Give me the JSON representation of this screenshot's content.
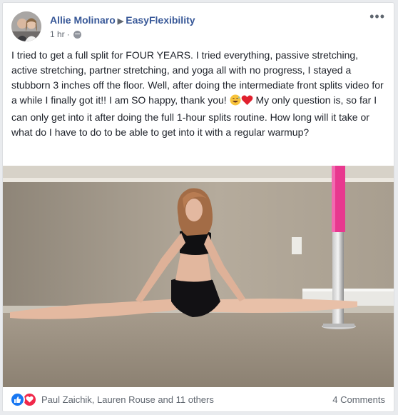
{
  "post": {
    "author": "Allie Molinaro",
    "group": "EasyFlexibility",
    "time": "1 hr",
    "dot": "·",
    "menu_glyph": "•••",
    "privacy_icon": "globe-icon",
    "text_main": "I tried to get a full split for FOUR YEARS. I tried everything, passive stretching, active stretching, partner stretching, and yoga all with no progress, I stayed a stubborn 3 inches off the floor. Well, after doing the intermediate front splits video for a while I finally got it!! I am SO happy, thank you! ",
    "text_rest": " My only question is, so far I can only get into it after doing the full 1-hour splits routine. How long will it take or what do I have to do to be able to get into it with a regular warmup?"
  },
  "footer": {
    "reaction_names": "Paul Zaichik, Lauren Rouse and 11 others",
    "comments": "4 Comments",
    "reaction_icons": [
      "like-icon",
      "love-icon"
    ]
  },
  "colors": {
    "link": "#385898",
    "text": "#1d2129",
    "secondary": "#606770",
    "like": "#1877f2",
    "love": "#f0284a",
    "pole": "#e8388f"
  }
}
